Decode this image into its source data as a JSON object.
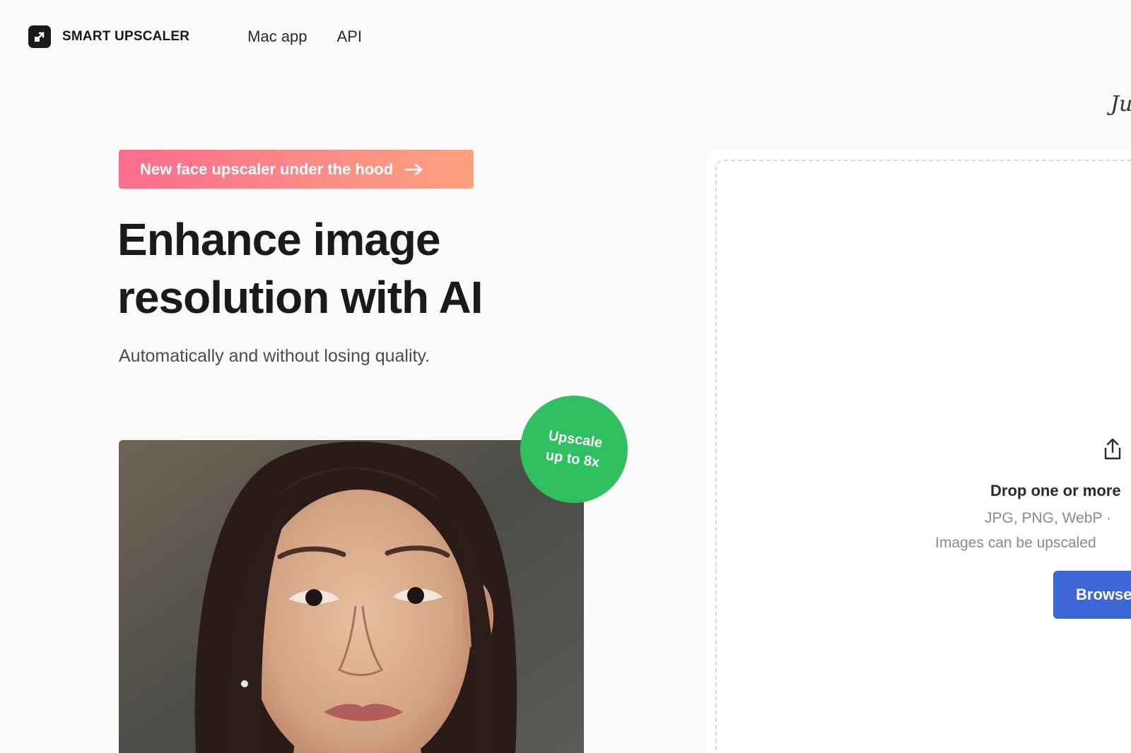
{
  "nav": {
    "brand": "SMART UPSCALER",
    "links": [
      "Mac app",
      "API"
    ]
  },
  "header_script_text": "Ju",
  "hero": {
    "promo_label": "New face upscaler under the hood",
    "headline_line1": "Enhance image",
    "headline_line2": "resolution with AI",
    "subheadline": "Automatically and without losing quality."
  },
  "badge": {
    "line1": "Upscale",
    "line2": "up to 8x"
  },
  "dropzone": {
    "title": "Drop one or more",
    "formats": "JPG, PNG, WebP ·",
    "note": "Images can be upscaled",
    "browse_label": "Browse"
  },
  "icons": {
    "brand": "upscale-arrow-icon",
    "promo": "arrow-right-icon",
    "upload": "upload-icon"
  },
  "colors": {
    "brand_dark": "#1a1a1e",
    "promo_start": "#fb6b8d",
    "promo_end": "#ffa17f",
    "badge_green": "#2fbf61",
    "browse_blue": "#3d66d6"
  }
}
